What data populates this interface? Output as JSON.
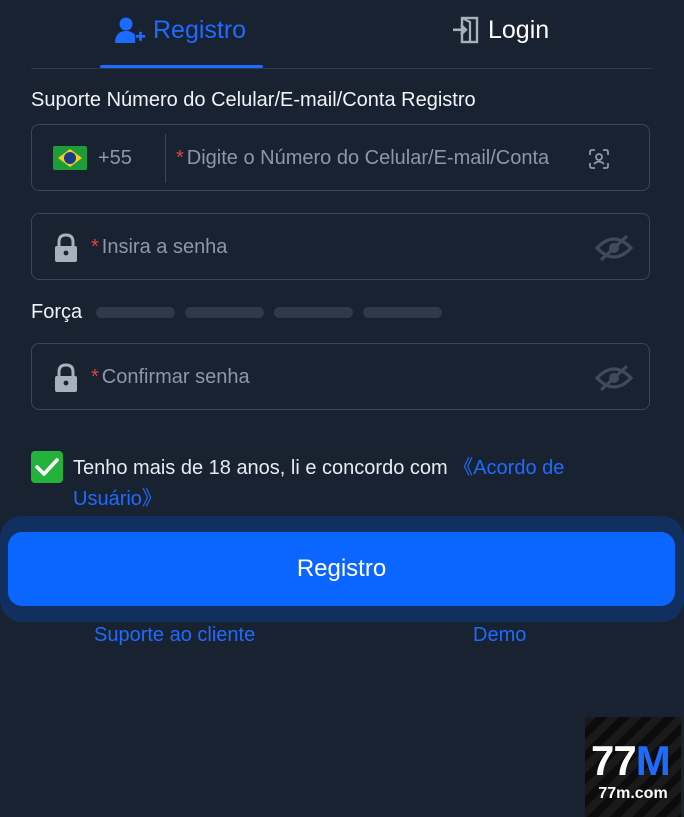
{
  "tabs": {
    "register_label": "Registro",
    "login_label": "Login"
  },
  "form": {
    "section_label": "Suporte Número do Celular/E-mail/Conta Registro",
    "country_code": "+55",
    "required_mark": "*",
    "account_placeholder": "Digite o Número do Celular/E-mail/Conta",
    "password_placeholder": "Insira a senha",
    "strength_label": "Força",
    "confirm_placeholder": "Confirmar senha"
  },
  "agreement": {
    "checked": true,
    "text": "Tenho mais de 18 anos, li e concordo com ",
    "link": "《Acordo de Usuário》"
  },
  "actions": {
    "submit_label": "Registro",
    "support_link": "Suporte ao cliente",
    "demo_link": "Demo"
  },
  "logo": {
    "main_white": "77",
    "main_blue": "M",
    "sub": "77m.com"
  },
  "colors": {
    "background": "#182230",
    "accent": "#1d6bff",
    "button": "#0a66ff",
    "checkbox": "#23b33a",
    "required": "#e0443f"
  },
  "icons": [
    "add-user-icon",
    "login-door-icon",
    "brazil-flag-icon",
    "face-scan-icon",
    "lock-icon",
    "eye-off-icon",
    "check-icon"
  ]
}
